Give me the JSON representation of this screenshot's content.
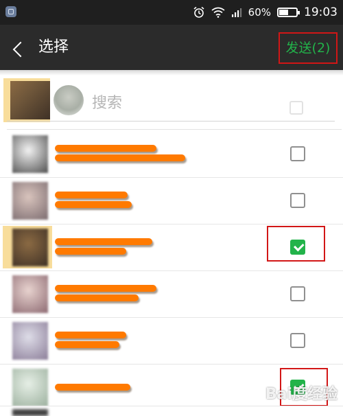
{
  "status_bar": {
    "battery_text": "60%",
    "battery_level": 0.6,
    "time": "19:03",
    "icons": [
      "photo-icon",
      "alarm-icon",
      "wifi-icon",
      "signal-icon",
      "battery-icon"
    ]
  },
  "header": {
    "title": "选择",
    "send_label": "发送(2)",
    "back_icon": "chevron-left-icon"
  },
  "search": {
    "placeholder": "搜索"
  },
  "contacts": [
    {
      "name": "",
      "checked": false,
      "avatar_colors": [
        "#f2f2f2",
        "#4f4f4f"
      ],
      "redaction_lines": 2
    },
    {
      "name": "",
      "checked": false,
      "avatar_colors": [
        "#d9c4bd",
        "#7c6c70"
      ],
      "redaction_lines": 2
    },
    {
      "name": "",
      "checked": true,
      "avatar_colors": [
        "#8b6a43",
        "#3f3126"
      ],
      "redaction_lines": 2
    },
    {
      "name": "",
      "checked": false,
      "avatar_colors": [
        "#e8d3cf",
        "#8d6a72"
      ],
      "redaction_lines": 2
    },
    {
      "name": "",
      "checked": false,
      "avatar_colors": [
        "#dedde8",
        "#8c7e99"
      ],
      "redaction_lines": 2
    },
    {
      "name": "",
      "checked": true,
      "avatar_colors": [
        "#e6efe6",
        "#9cb09e"
      ],
      "redaction_lines": 1
    }
  ],
  "watermark": "Bai度经验",
  "colors": {
    "accent_green": "#22b34a",
    "highlight_red": "#d21616",
    "redaction_orange": "#ff7a00",
    "selected_bg": "#f8dd9b",
    "title_bar": "#2b2b2b"
  }
}
